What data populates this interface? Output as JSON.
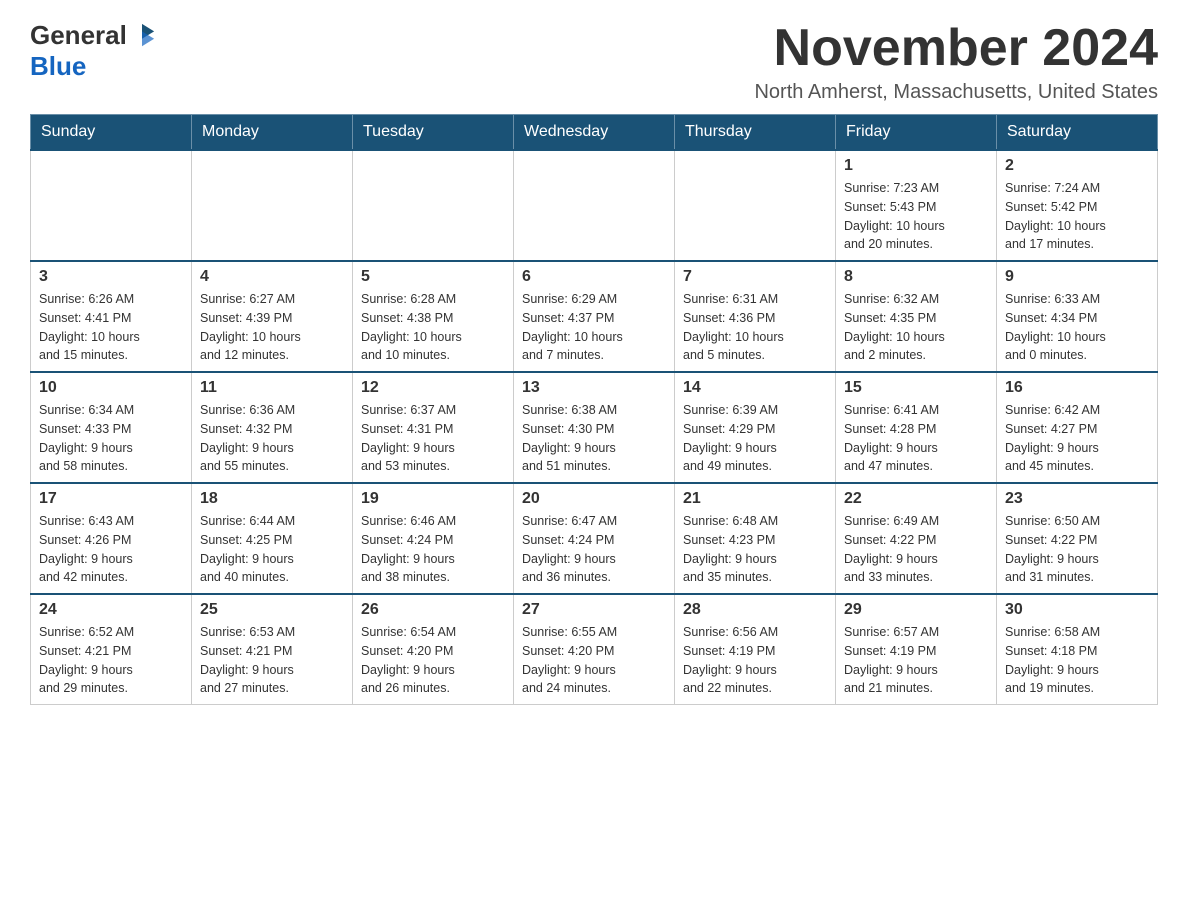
{
  "logo": {
    "general": "General",
    "blue": "Blue"
  },
  "title": "November 2024",
  "location": "North Amherst, Massachusetts, United States",
  "days_of_week": [
    "Sunday",
    "Monday",
    "Tuesday",
    "Wednesday",
    "Thursday",
    "Friday",
    "Saturday"
  ],
  "weeks": [
    [
      {
        "day": "",
        "info": ""
      },
      {
        "day": "",
        "info": ""
      },
      {
        "day": "",
        "info": ""
      },
      {
        "day": "",
        "info": ""
      },
      {
        "day": "",
        "info": ""
      },
      {
        "day": "1",
        "info": "Sunrise: 7:23 AM\nSunset: 5:43 PM\nDaylight: 10 hours\nand 20 minutes."
      },
      {
        "day": "2",
        "info": "Sunrise: 7:24 AM\nSunset: 5:42 PM\nDaylight: 10 hours\nand 17 minutes."
      }
    ],
    [
      {
        "day": "3",
        "info": "Sunrise: 6:26 AM\nSunset: 4:41 PM\nDaylight: 10 hours\nand 15 minutes."
      },
      {
        "day": "4",
        "info": "Sunrise: 6:27 AM\nSunset: 4:39 PM\nDaylight: 10 hours\nand 12 minutes."
      },
      {
        "day": "5",
        "info": "Sunrise: 6:28 AM\nSunset: 4:38 PM\nDaylight: 10 hours\nand 10 minutes."
      },
      {
        "day": "6",
        "info": "Sunrise: 6:29 AM\nSunset: 4:37 PM\nDaylight: 10 hours\nand 7 minutes."
      },
      {
        "day": "7",
        "info": "Sunrise: 6:31 AM\nSunset: 4:36 PM\nDaylight: 10 hours\nand 5 minutes."
      },
      {
        "day": "8",
        "info": "Sunrise: 6:32 AM\nSunset: 4:35 PM\nDaylight: 10 hours\nand 2 minutes."
      },
      {
        "day": "9",
        "info": "Sunrise: 6:33 AM\nSunset: 4:34 PM\nDaylight: 10 hours\nand 0 minutes."
      }
    ],
    [
      {
        "day": "10",
        "info": "Sunrise: 6:34 AM\nSunset: 4:33 PM\nDaylight: 9 hours\nand 58 minutes."
      },
      {
        "day": "11",
        "info": "Sunrise: 6:36 AM\nSunset: 4:32 PM\nDaylight: 9 hours\nand 55 minutes."
      },
      {
        "day": "12",
        "info": "Sunrise: 6:37 AM\nSunset: 4:31 PM\nDaylight: 9 hours\nand 53 minutes."
      },
      {
        "day": "13",
        "info": "Sunrise: 6:38 AM\nSunset: 4:30 PM\nDaylight: 9 hours\nand 51 minutes."
      },
      {
        "day": "14",
        "info": "Sunrise: 6:39 AM\nSunset: 4:29 PM\nDaylight: 9 hours\nand 49 minutes."
      },
      {
        "day": "15",
        "info": "Sunrise: 6:41 AM\nSunset: 4:28 PM\nDaylight: 9 hours\nand 47 minutes."
      },
      {
        "day": "16",
        "info": "Sunrise: 6:42 AM\nSunset: 4:27 PM\nDaylight: 9 hours\nand 45 minutes."
      }
    ],
    [
      {
        "day": "17",
        "info": "Sunrise: 6:43 AM\nSunset: 4:26 PM\nDaylight: 9 hours\nand 42 minutes."
      },
      {
        "day": "18",
        "info": "Sunrise: 6:44 AM\nSunset: 4:25 PM\nDaylight: 9 hours\nand 40 minutes."
      },
      {
        "day": "19",
        "info": "Sunrise: 6:46 AM\nSunset: 4:24 PM\nDaylight: 9 hours\nand 38 minutes."
      },
      {
        "day": "20",
        "info": "Sunrise: 6:47 AM\nSunset: 4:24 PM\nDaylight: 9 hours\nand 36 minutes."
      },
      {
        "day": "21",
        "info": "Sunrise: 6:48 AM\nSunset: 4:23 PM\nDaylight: 9 hours\nand 35 minutes."
      },
      {
        "day": "22",
        "info": "Sunrise: 6:49 AM\nSunset: 4:22 PM\nDaylight: 9 hours\nand 33 minutes."
      },
      {
        "day": "23",
        "info": "Sunrise: 6:50 AM\nSunset: 4:22 PM\nDaylight: 9 hours\nand 31 minutes."
      }
    ],
    [
      {
        "day": "24",
        "info": "Sunrise: 6:52 AM\nSunset: 4:21 PM\nDaylight: 9 hours\nand 29 minutes."
      },
      {
        "day": "25",
        "info": "Sunrise: 6:53 AM\nSunset: 4:21 PM\nDaylight: 9 hours\nand 27 minutes."
      },
      {
        "day": "26",
        "info": "Sunrise: 6:54 AM\nSunset: 4:20 PM\nDaylight: 9 hours\nand 26 minutes."
      },
      {
        "day": "27",
        "info": "Sunrise: 6:55 AM\nSunset: 4:20 PM\nDaylight: 9 hours\nand 24 minutes."
      },
      {
        "day": "28",
        "info": "Sunrise: 6:56 AM\nSunset: 4:19 PM\nDaylight: 9 hours\nand 22 minutes."
      },
      {
        "day": "29",
        "info": "Sunrise: 6:57 AM\nSunset: 4:19 PM\nDaylight: 9 hours\nand 21 minutes."
      },
      {
        "day": "30",
        "info": "Sunrise: 6:58 AM\nSunset: 4:18 PM\nDaylight: 9 hours\nand 19 minutes."
      }
    ]
  ]
}
